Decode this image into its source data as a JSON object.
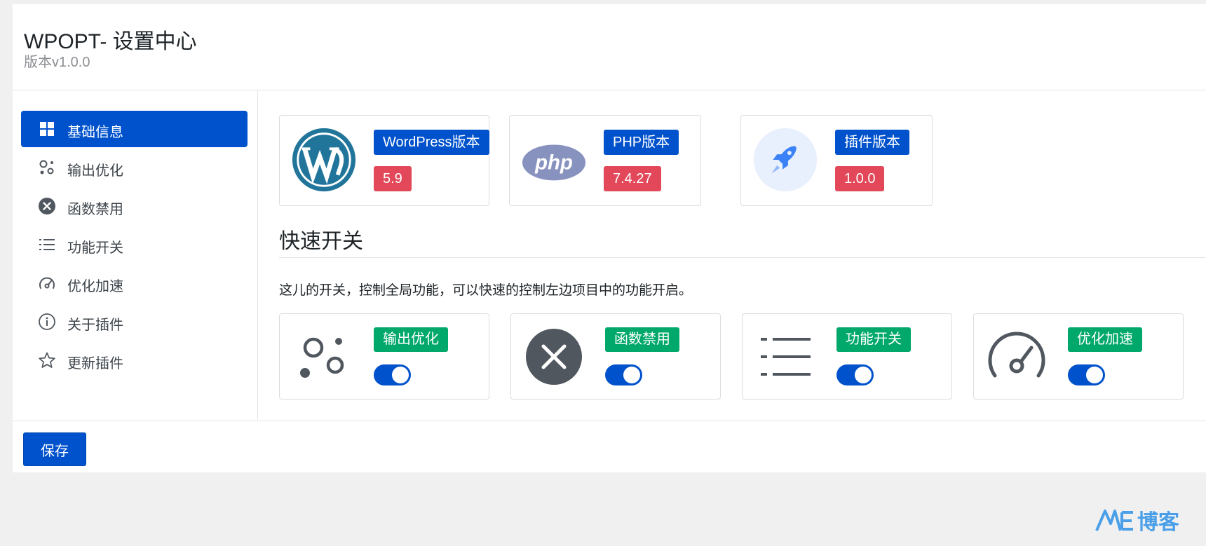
{
  "header": {
    "title": "WPOPT- 设置中心",
    "version": "版本v1.0.0"
  },
  "sidebar": {
    "items": [
      {
        "label": "基础信息",
        "icon": "grid-icon",
        "active": true
      },
      {
        "label": "输出优化",
        "icon": "bubbles-icon"
      },
      {
        "label": "函数禁用",
        "icon": "close-circle-icon"
      },
      {
        "label": "功能开关",
        "icon": "list-icon"
      },
      {
        "label": "优化加速",
        "icon": "speedometer-icon"
      },
      {
        "label": "关于插件",
        "icon": "info-icon"
      },
      {
        "label": "更新插件",
        "icon": "star-icon"
      }
    ]
  },
  "versions": [
    {
      "label": "WordPress版本",
      "value": "5.9",
      "icon": "wordpress-logo"
    },
    {
      "label": "PHP版本",
      "value": "7.4.27",
      "icon": "php-logo"
    },
    {
      "label": "插件版本",
      "value": "1.0.0",
      "icon": "rocket-icon"
    }
  ],
  "quick": {
    "title": "快速开关",
    "description": "这儿的开关，控制全局功能，可以快速的控制左边项目中的功能开启。",
    "switches": [
      {
        "label": "输出优化",
        "icon": "bubbles-icon",
        "on": true
      },
      {
        "label": "函数禁用",
        "icon": "close-circle-icon",
        "on": true
      },
      {
        "label": "功能开关",
        "icon": "list-icon",
        "on": true
      },
      {
        "label": "优化加速",
        "icon": "speedometer-icon",
        "on": true
      }
    ]
  },
  "footer": {
    "save_label": "保存"
  },
  "watermark": {
    "text": "博客"
  },
  "colors": {
    "primary": "#0052cc",
    "danger": "#e2475a",
    "success": "#00a86b",
    "wordpress": "#21759b",
    "php": "#8892bf"
  }
}
